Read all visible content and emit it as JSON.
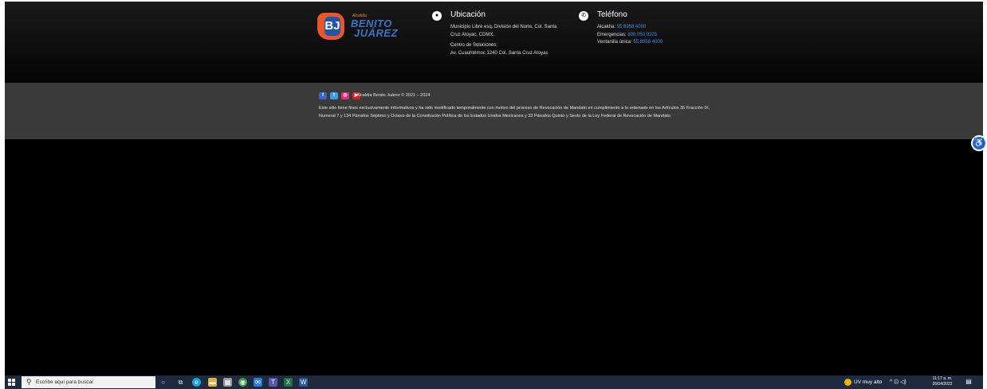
{
  "logo": {
    "badge": "BJ",
    "kicker": "Alcaldía",
    "line1": "BENITO",
    "line2": "JUÁREZ"
  },
  "location": {
    "icon": "map-pin-icon",
    "title": "Ubicación",
    "address": "Municipio Libre esq. División del Norte, Col. Santa Cruz Atoyac, CDMX.",
    "center_label": "Centro de Soluciones:",
    "center_address": "Av. Cuauhtémoc 1240 Col. Santa Cruz Atoyac"
  },
  "phone": {
    "icon": "phone-icon",
    "title": "Teléfono",
    "lines": [
      {
        "label": "Alcaldía:",
        "number": "55 8958 4000"
      },
      {
        "label": "Emergencias:",
        "number": "800 050 0225"
      },
      {
        "label": "Ventanilla única:",
        "number": "55 8958 4000"
      }
    ]
  },
  "social": {
    "icons": [
      "facebook-icon",
      "twitter-icon",
      "instagram-icon",
      "youtube-icon"
    ],
    "copyright": "Alcaldía Benito Juárez © 2021 – 2024"
  },
  "disclaimer": "Este sitio tiene fines exclusivamente informativos y ha sido modificado temporalmente con motivo del proceso de Revocación de Mandato en cumplimiento a lo ordenado en los Artículos 35 Fracción IX, Numeral 7 y 134 Párrafos Séptimo y Octavo de la Constitución Política de los Estados Unidos Mexicanos y 33 Párrafos Quinto y Sexto de la Ley Federal de Revocación de Mandato.",
  "accessibility": {
    "icon": "accessibility-icon"
  },
  "taskbar": {
    "search_placeholder": "Escribe aquí para buscar",
    "weather": "UV muy alto",
    "time": "11:17 a. m.",
    "date": "26/04/2022"
  },
  "colors": {
    "link": "#3e8ee6",
    "footer_bottom": "#3a3a3a",
    "taskbar": "#1e2a3e"
  }
}
